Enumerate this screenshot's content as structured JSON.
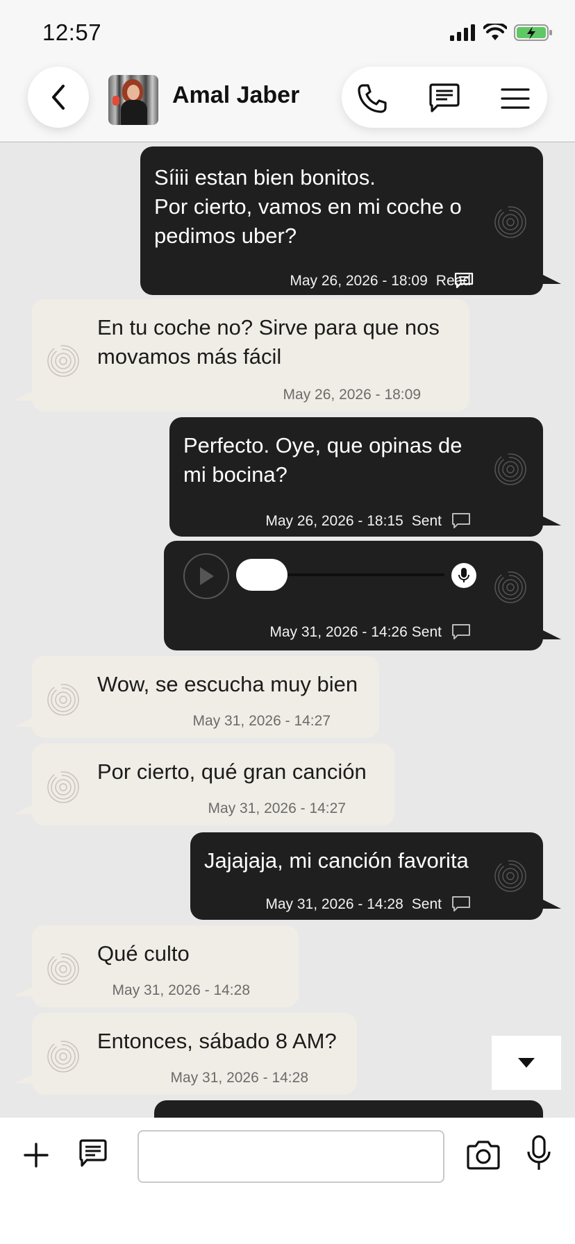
{
  "status_bar": {
    "time": "12:57"
  },
  "header": {
    "contact_name": "Amal Jaber",
    "icons": [
      "back-arrow",
      "phone",
      "message-square",
      "menu"
    ]
  },
  "messages": [
    {
      "direction": "out",
      "text": "Síiii estan bien bonitos.\nPor cierto, vamos en mi coche o pedimos uber?",
      "timestamp": "May 26, 2026 - 18:09",
      "status": "Read"
    },
    {
      "direction": "in",
      "text": "En tu coche no? Sirve para que nos movamos más fácil",
      "timestamp": "May 26, 2026 - 18:09"
    },
    {
      "direction": "out",
      "text": "Perfecto. Oye, que opinas de mi bocina?",
      "timestamp": "May 26, 2026 - 18:15",
      "status": "Sent"
    },
    {
      "direction": "out",
      "type": "audio",
      "timestamp": "May 31, 2026 - 14:26",
      "status": "Sent",
      "progress": 0
    },
    {
      "direction": "in",
      "text": "Wow, se escucha muy bien",
      "timestamp": "May 31, 2026 - 14:27"
    },
    {
      "direction": "in",
      "text": "Por cierto, qué gran canción",
      "timestamp": "May 31, 2026 - 14:27"
    },
    {
      "direction": "out",
      "text": "Jajajaja, mi canción favorita",
      "timestamp": "May 31, 2026 - 14:28",
      "status": "Sent"
    },
    {
      "direction": "in",
      "text": "Qué culto",
      "timestamp": "May 31, 2026 - 14:28"
    },
    {
      "direction": "in",
      "text": "Entonces, sábado 8 AM?",
      "timestamp": "May 31, 2026 - 14:28"
    }
  ],
  "composer": {
    "message_value": "",
    "icons": [
      "plus",
      "message-square",
      "camera",
      "microphone"
    ]
  },
  "colors": {
    "outgoing_bubble": "#1f1f1f",
    "incoming_bubble": "#f0ede6",
    "chat_background": "#e8e8e8",
    "battery": "#5fc865"
  }
}
